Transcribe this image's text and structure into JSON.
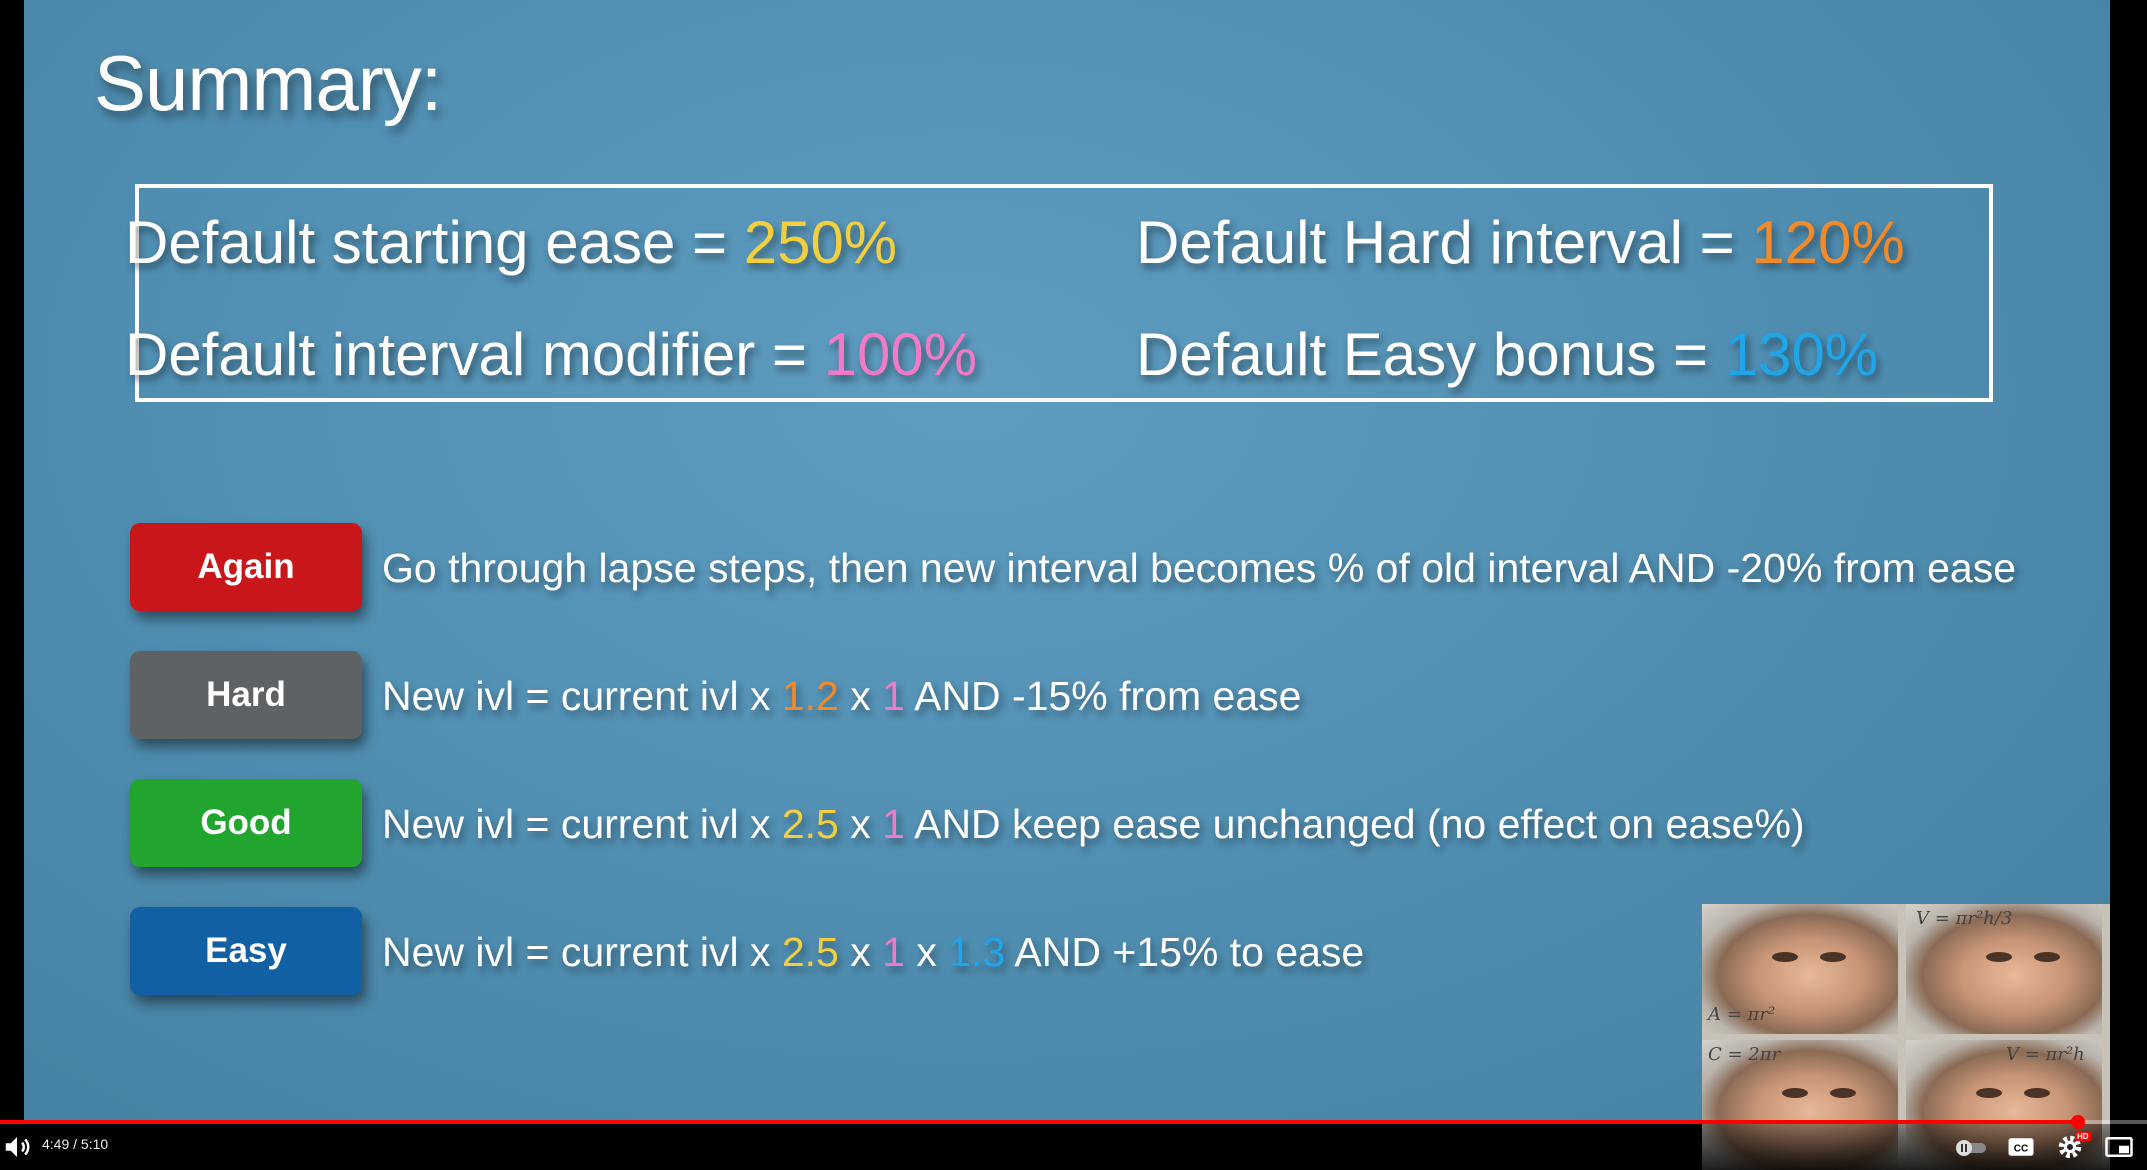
{
  "slide": {
    "title": "Summary:",
    "defaults": [
      {
        "label": "Default starting ease = ",
        "value": "250%",
        "color": "#f2cf3e"
      },
      {
        "label": "Default interval modifier = ",
        "value": "100%",
        "color": "#f07ac8"
      },
      {
        "label": "Default Hard interval = ",
        "value": "120%",
        "color": "#f08a2a"
      },
      {
        "label": "Default Easy bonus = ",
        "value": "130%",
        "color": "#1fa6ea"
      }
    ],
    "rules": [
      {
        "button": "Again",
        "color": "#c8161b",
        "desc": "Go through lapse steps, then new interval becomes % of old interval AND -20% from ease"
      },
      {
        "button": "Hard",
        "color": "#5f6265",
        "desc_pre": "New ivl = current ivl x ",
        "factor1": "1.2",
        "mid1": " x ",
        "factor2": "1",
        "desc_post": " AND -15% from ease"
      },
      {
        "button": "Good",
        "color": "#22a52e",
        "desc_pre": "New ivl = current ivl x ",
        "factor1": "2.5",
        "mid1": " x ",
        "factor2": "1",
        "desc_post": " AND keep ease unchanged (no effect on ease%)"
      },
      {
        "button": "Easy",
        "color": "#1160a3",
        "desc_pre": "New ivl = current ivl x ",
        "factor1": "2.5",
        "mid1": " x ",
        "factor2": "1",
        "mid2": " x ",
        "factor3": "1.3",
        "desc_post": " AND +15% to ease"
      }
    ]
  },
  "thumbnail": {
    "math": [
      "V = πr²h/3",
      "A = πr²",
      "C = 2πr",
      "V = πr²h"
    ]
  },
  "player": {
    "time": "4:49 / 5:10",
    "progress": 0.9677,
    "icons": [
      "volume-icon",
      "autoplay-toggle-icon",
      "captions-icon",
      "settings-icon",
      "miniplayer-icon"
    ],
    "hd_badge": "HD"
  }
}
